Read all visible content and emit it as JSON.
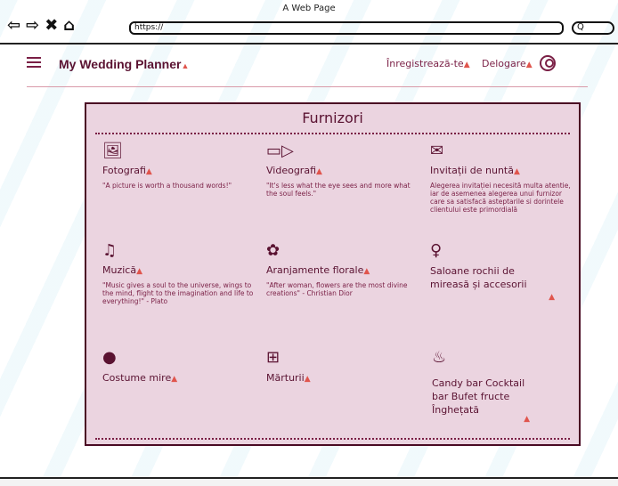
{
  "browser": {
    "window_title": "A Web Page",
    "url": "https://",
    "search_glyph": "Q"
  },
  "header": {
    "brand": "My Wedding Planner",
    "register": "Înregistrează-te",
    "logout": "Delogare"
  },
  "section": {
    "title": "Furnizori"
  },
  "vendors": [
    {
      "icon": "photos-icon",
      "title": "Fotografi",
      "desc": "\"A picture is worth a thousand words!\""
    },
    {
      "icon": "video-icon",
      "title": "Videografi",
      "desc": "\"It's less what the eye sees and more what the soul feels.\""
    },
    {
      "icon": "mail-icon",
      "title": "Invitații de nuntă",
      "desc": "Alegerea invitației necesită multa atentie, iar de asemenea alegerea unui furnizor care sa satisfacă asteptarile si dorintele clientului este primordială"
    },
    {
      "icon": "music-icon",
      "title": "Muzică",
      "desc": "\"Music gives a soul to the universe, wings to the mind, flight to the imagination and life to everything!\" - Plato"
    },
    {
      "icon": "flower-icon",
      "title": "Aranjamente florale",
      "desc": "\"After woman, flowers are the most divine creations\" - Christian Dior"
    },
    {
      "icon": "dress-icon",
      "title": "Saloane rochii de mireasă și accesorii",
      "desc": ""
    },
    {
      "icon": "groom-icon",
      "title": "Costume mire",
      "desc": ""
    },
    {
      "icon": "gift-icon",
      "title": "Mărturii",
      "desc": ""
    },
    {
      "icon": "cupcake-icon",
      "title": "Candy bar Cocktail bar Bufet fructe Înghețată",
      "desc": ""
    }
  ]
}
